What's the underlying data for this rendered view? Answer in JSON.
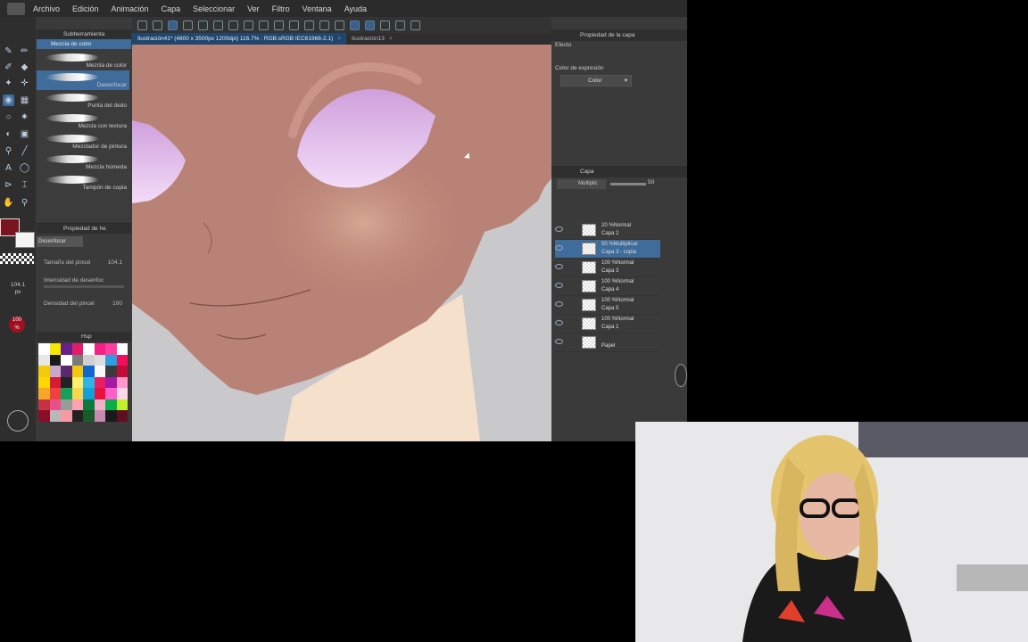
{
  "menu": [
    "Archivo",
    "Edición",
    "Animación",
    "Capa",
    "Seleccionar",
    "Ver",
    "Filtro",
    "Ventana",
    "Ayuda"
  ],
  "tabs": [
    {
      "label": "Ilustración41* (4800 x 3500px 1200dpi) 116.7% : RGB:sRGB IEC61966-2.1)"
    },
    {
      "label": "Ilustración13"
    }
  ],
  "subtool": {
    "header": "Subherramienta",
    "title_active": "Mezcla de color",
    "brushes": [
      "Mezcla de color",
      "Desenfocar",
      "Punta del dedo",
      "Mezcla con textura",
      "Mezclador de pintura",
      "Mezcla húmeda",
      "Tampón de copia"
    ],
    "selected_index": 1
  },
  "tool_property": {
    "header": "Propiedad de he",
    "brush_name": "Desenfocar",
    "rows": [
      {
        "label": "Tamaño del pincel",
        "value": "104.1"
      },
      {
        "label": "Intensidad de desenfoc",
        "value": ""
      },
      {
        "label": "Densidad del pincel",
        "value": "100"
      }
    ]
  },
  "brush_size_readout": {
    "value": "104.1",
    "unit": "px"
  },
  "opacity_badge": {
    "value": "100",
    "unit": "%"
  },
  "palette": {
    "header": "Hsp",
    "colors": [
      "#ffffff",
      "#f6e700",
      "#6a1f8a",
      "#e11d6b",
      "#ffffff",
      "#f61f8a",
      "#ff3fa0",
      "#ffffff",
      "#e8e8e8",
      "#1a1a1a",
      "#ffffff",
      "#7a7a7a",
      "#cfcfcf",
      "#dddddd",
      "#2ba0e0",
      "#f20f5a",
      "#f3c90c",
      "#c8a8c8",
      "#5a2a6a",
      "#f2c80c",
      "#1166cc",
      "#f8f8f8",
      "#3b3b3b",
      "#c50a3a",
      "#ffd700",
      "#d71a35",
      "#222222",
      "#ffef6a",
      "#30b4e6",
      "#e91e63",
      "#a41aa4",
      "#ff98c9",
      "#f7a62a",
      "#f04040",
      "#17a05a",
      "#f9d74a",
      "#12a0dc",
      "#e8103c",
      "#ff5fc9",
      "#ffd7e8",
      "#c83246",
      "#e8508a",
      "#9a9a9a",
      "#ffa0b4",
      "#0b7a3a",
      "#f2b0c8",
      "#08ae4a",
      "#c1ef2a",
      "#8a0d2a",
      "#b8b8b8",
      "#f89aa2",
      "#222222",
      "#1a5a2a",
      "#c98ab0",
      "#1a1a1a",
      "#5f0f1f"
    ]
  },
  "right_panel": {
    "prop_header": "Propiedad de la capa",
    "effect_label": "Efecto",
    "expr_label": "Color de expresión",
    "expr_value": "Color",
    "layer_header": "Capa",
    "blend_mode": "Multiplic",
    "opacity": "50",
    "layers": [
      {
        "line1": "20 %Normal",
        "line2": "Capa 2",
        "selected": false
      },
      {
        "line1": "50 %Multiplicar",
        "line2": "Capa 3 - copia",
        "selected": true
      },
      {
        "line1": "100 %Normal",
        "line2": "Capa 3",
        "selected": false
      },
      {
        "line1": "100 %Normal",
        "line2": "Capa 4",
        "selected": false
      },
      {
        "line1": "100 %Normal",
        "line2": "Capa 5",
        "selected": false
      },
      {
        "line1": "100 %Normal",
        "line2": "Capa 1",
        "selected": false
      },
      {
        "line1": "",
        "line2": "Papel",
        "selected": false
      }
    ]
  },
  "colors": {
    "main_color": "#7a1420",
    "sub_color": "#f4f4f4",
    "skin": "#b98276",
    "eye": "#d9b5e6",
    "background": "#c9c9cb",
    "accent": "#3f6c9a"
  }
}
